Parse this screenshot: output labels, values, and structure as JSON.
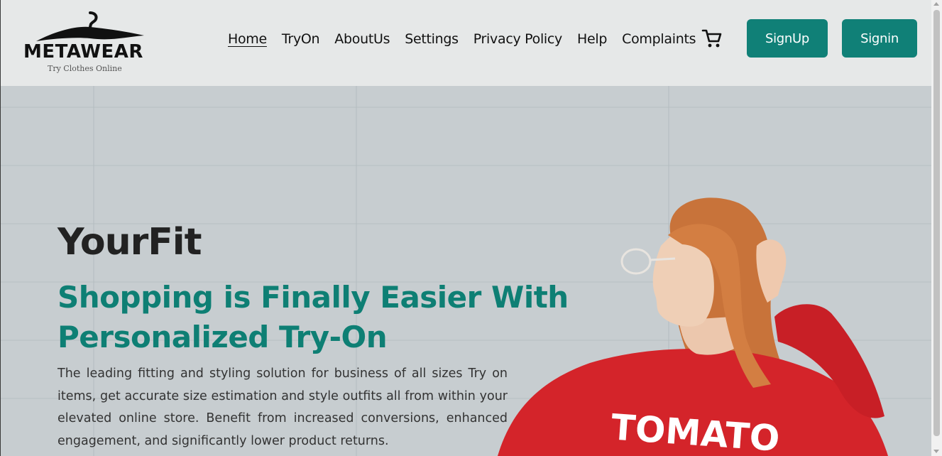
{
  "brand": {
    "name": "METAWEAR",
    "tagline": "Try Clothes Online"
  },
  "nav": {
    "items": [
      {
        "label": "Home",
        "active": true
      },
      {
        "label": "TryOn"
      },
      {
        "label": "AboutUs"
      },
      {
        "label": "Settings"
      },
      {
        "label": "Privacy Policy"
      },
      {
        "label": "Help"
      },
      {
        "label": "Complaints"
      }
    ],
    "cart_icon": "shopping-cart-icon"
  },
  "auth": {
    "signup_label": "SignUp",
    "signin_label": "Signin"
  },
  "hero": {
    "title": "YourFit",
    "headline": "Shopping is Finally Easier With Personalized Try-On",
    "description": "The leading fitting and styling solution for business of all sizes Try on items, get accurate size estimation and style outfits all from within your elevated online store. Benefit from increased conversions, enhanced engagement, and significantly lower product returns.",
    "model_shirt_text": "TOMATO"
  },
  "colors": {
    "accent": "#108077",
    "header_bg": "#e6e8e8",
    "hero_bg": "#c9cfd1",
    "shirt": "#d4242a"
  }
}
